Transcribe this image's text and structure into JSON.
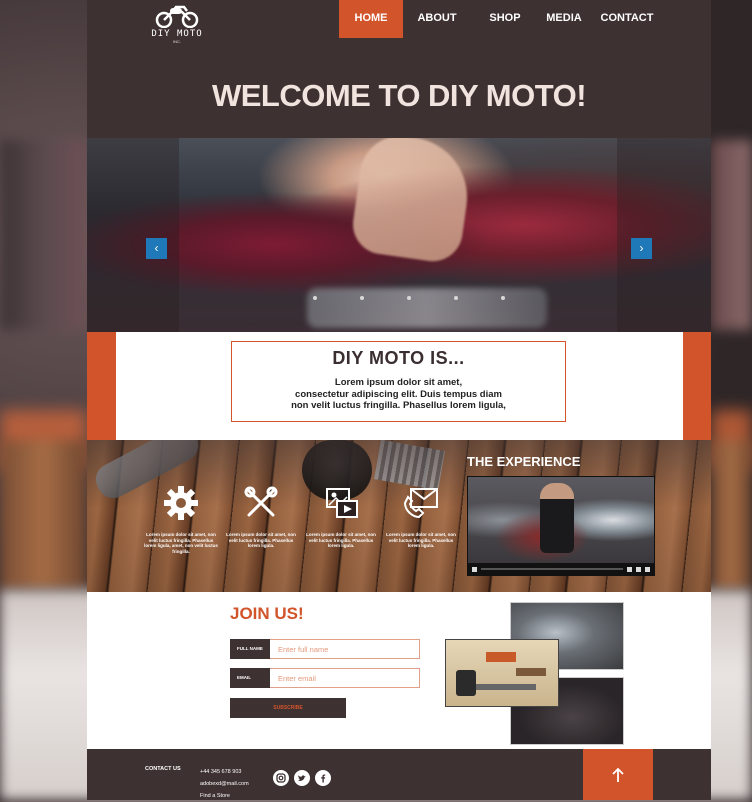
{
  "logo": {
    "name": "DIY MOTO",
    "sub": "INC."
  },
  "nav": [
    {
      "label": "HOME",
      "active": true
    },
    {
      "label": "ABOUT"
    },
    {
      "label": "SHOP"
    },
    {
      "label": "MEDIA"
    },
    {
      "label": "CONTACT"
    }
  ],
  "welcome": "WELCOME TO DIY MOTO!",
  "slider": {
    "prev_icon": "chevron-left-icon",
    "next_icon": "chevron-right-icon",
    "slide_count": 5
  },
  "about": {
    "title": "DIY MOTO IS...",
    "lines": [
      "Lorem ipsum dolor sit amet,",
      "consectetur adipiscing elit. Duis tempus diam",
      "non velit luctus fringilla. Phasellus lorem ligula,"
    ]
  },
  "features": [
    {
      "icon": "gear-icon",
      "text": "Lorem ipsum dolor sit amet, non velit luctus fringilla. Phasellus lorem ligula, amet, non velit luctus fringilla."
    },
    {
      "icon": "tools-icon",
      "text": "Lorem ipsum dolor sit amet, non velit luctus fringilla. Phasellus lorem ligula."
    },
    {
      "icon": "media-icon",
      "text": "Lorem ipsum dolor sit amet, non velit luctus fringilla. Phasellus lorem ligula."
    },
    {
      "icon": "mail-icon",
      "text": "Lorem ipsum dolor sit amet, non velit luctus fringilla. Phasellus lorem ligula."
    }
  ],
  "experience": {
    "title": "THE EXPERIENCE"
  },
  "join": {
    "title": "JOIN US!",
    "name_label": "FULL NAME",
    "name_placeholder": "Enter full name",
    "email_label": "EMAIL",
    "email_placeholder": "Enter email",
    "subscribe_label": "SUBSCRIBE"
  },
  "footer": {
    "contact_label": "CONTACT US",
    "phone": "+44 345 678 903",
    "email": "adobexd@mail.com",
    "store": "Find a Store",
    "social": [
      "instagram-icon",
      "twitter-icon",
      "facebook-icon"
    ],
    "top_icon": "arrow-up-icon"
  },
  "colors": {
    "accent": "#d1542b",
    "dark": "#3e3132",
    "slider_arrow": "#1f78b8"
  }
}
